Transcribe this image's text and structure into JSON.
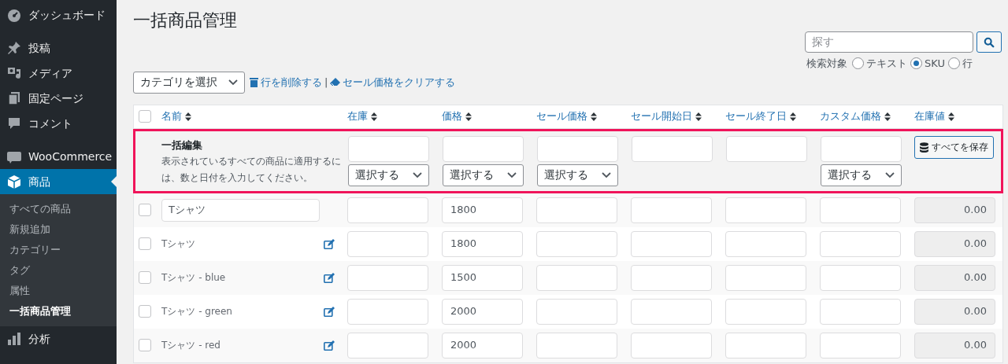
{
  "sidebar": {
    "items": [
      {
        "label": "ダッシュボード",
        "selected": false
      },
      {
        "label": "投稿",
        "selected": false
      },
      {
        "label": "メディア",
        "selected": false
      },
      {
        "label": "固定ページ",
        "selected": false
      },
      {
        "label": "コメント",
        "selected": false
      },
      {
        "label": "WooCommerce",
        "selected": false
      },
      {
        "label": "商品",
        "selected": true,
        "children": [
          {
            "label": "すべての商品",
            "selected": false
          },
          {
            "label": "新規追加",
            "selected": false
          },
          {
            "label": "カテゴリー",
            "selected": false
          },
          {
            "label": "タグ",
            "selected": false
          },
          {
            "label": "属性",
            "selected": false
          },
          {
            "label": "一括商品管理",
            "selected": true
          }
        ]
      },
      {
        "label": "分析",
        "selected": false
      }
    ]
  },
  "page_title": "一括商品管理",
  "search": {
    "placeholder": "探す",
    "target_label": "検索対象",
    "options": [
      {
        "label": "テキスト",
        "selected": false
      },
      {
        "label": "SKU",
        "selected": true
      },
      {
        "label": "行",
        "selected": false
      }
    ]
  },
  "toolbar": {
    "category_select": "カテゴリを選択",
    "delete_link": "行を削除する",
    "separator": "|",
    "clear_link": "セール価格をクリアする"
  },
  "table": {
    "header_checked": false,
    "columns": [
      "名前",
      "在庫",
      "価格",
      "セール価格",
      "セール開始日",
      "セール終了日",
      "カスタム価格",
      "在庫値"
    ],
    "bulk_edit": {
      "title": "一括編集",
      "description": "表示されているすべての商品に適用するには、数と日付を入力してください。",
      "cells": [
        {
          "kind": "input_select",
          "select": "選択する"
        },
        {
          "kind": "input_select",
          "select": "選択する"
        },
        {
          "kind": "input_select",
          "select": "選択する"
        },
        {
          "kind": "input"
        },
        {
          "kind": "input"
        },
        {
          "kind": "input_select",
          "select": "選択する"
        }
      ],
      "save_button": "すべてを保存"
    },
    "rows": [
      {
        "kind": "editing",
        "checked": false,
        "name": "Tシャツ",
        "price": "1800",
        "stock_value": "0.00"
      },
      {
        "kind": "text",
        "checked": false,
        "name": "Tシャツ",
        "price": "1800",
        "stock_value": "0.00"
      },
      {
        "kind": "text",
        "checked": false,
        "name": "Tシャツ - blue",
        "price": "1500",
        "stock_value": "0.00"
      },
      {
        "kind": "text",
        "checked": false,
        "name": "Tシャツ - green",
        "price": "2000",
        "stock_value": "0.00"
      },
      {
        "kind": "text",
        "checked": false,
        "name": "Tシャツ - red",
        "price": "2000",
        "stock_value": "0.00"
      }
    ]
  }
}
